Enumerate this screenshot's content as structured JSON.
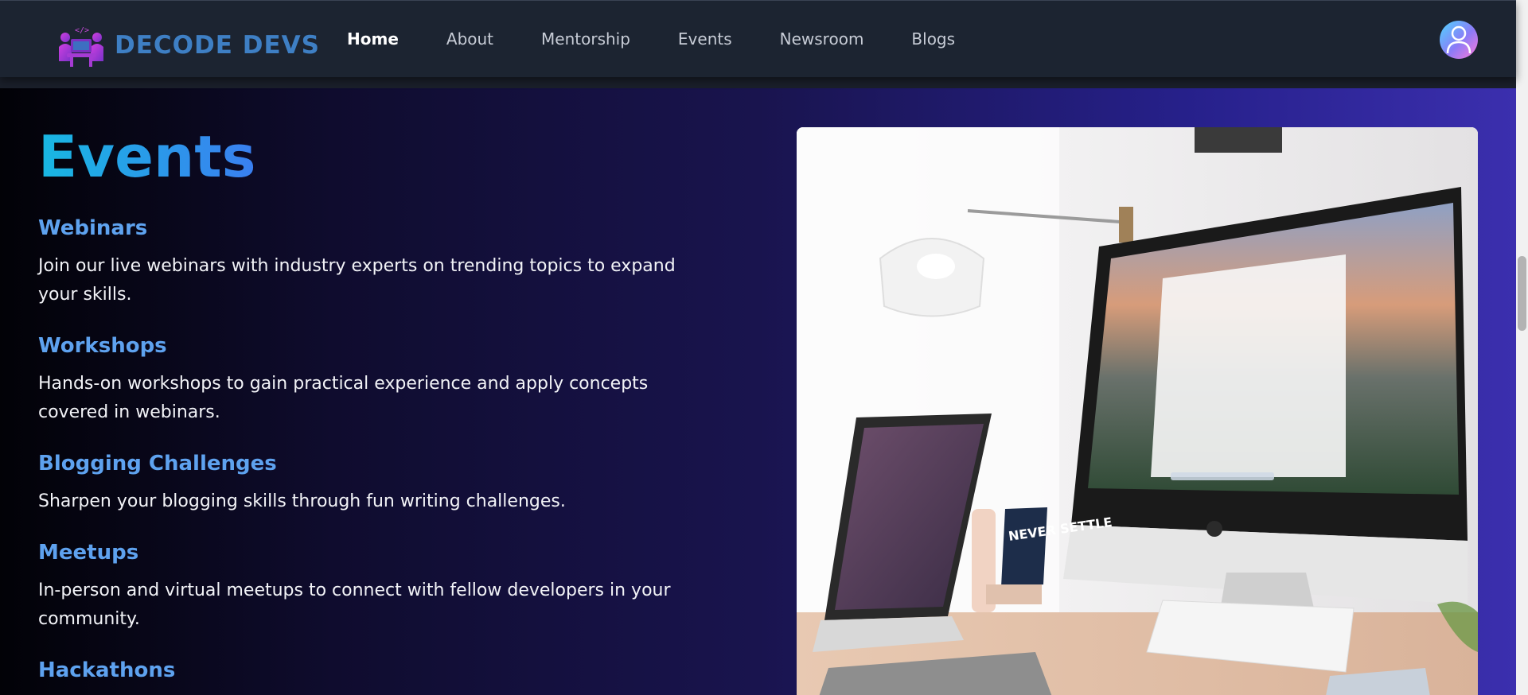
{
  "header": {
    "brand": "DECODE DEVS",
    "logo_icon": "code-laptop-team-logo",
    "nav": [
      {
        "label": "Home",
        "active": true
      },
      {
        "label": "About",
        "active": false
      },
      {
        "label": "Mentorship",
        "active": false
      },
      {
        "label": "Events",
        "active": false
      },
      {
        "label": "Newsroom",
        "active": false
      },
      {
        "label": "Blogs",
        "active": false
      }
    ],
    "avatar_icon": "user-avatar-icon"
  },
  "events_section": {
    "title": "Events",
    "items": [
      {
        "title": "Webinars",
        "description": "Join our live webinars with industry experts on trending topics to expand your skills."
      },
      {
        "title": "Workshops",
        "description": "Hands-on workshops to gain practical experience and apply concepts covered in webinars."
      },
      {
        "title": "Blogging Challenges",
        "description": "Sharpen your blogging skills through fun writing challenges."
      },
      {
        "title": "Meetups",
        "description": "In-person and virtual meetups to connect with fellow developers in your community."
      },
      {
        "title": "Hackathons",
        "description": ""
      }
    ],
    "image": {
      "subject": "desk-setup-photo",
      "poster_text": "NEVER SETTLE"
    }
  },
  "colors": {
    "nav_bg": "#1c2431",
    "accent_blue": "#5ea2ef",
    "title_gradient_start": "#18b8e2",
    "title_gradient_end": "#3a7ff0",
    "brand_purple": "#b53fd8"
  }
}
